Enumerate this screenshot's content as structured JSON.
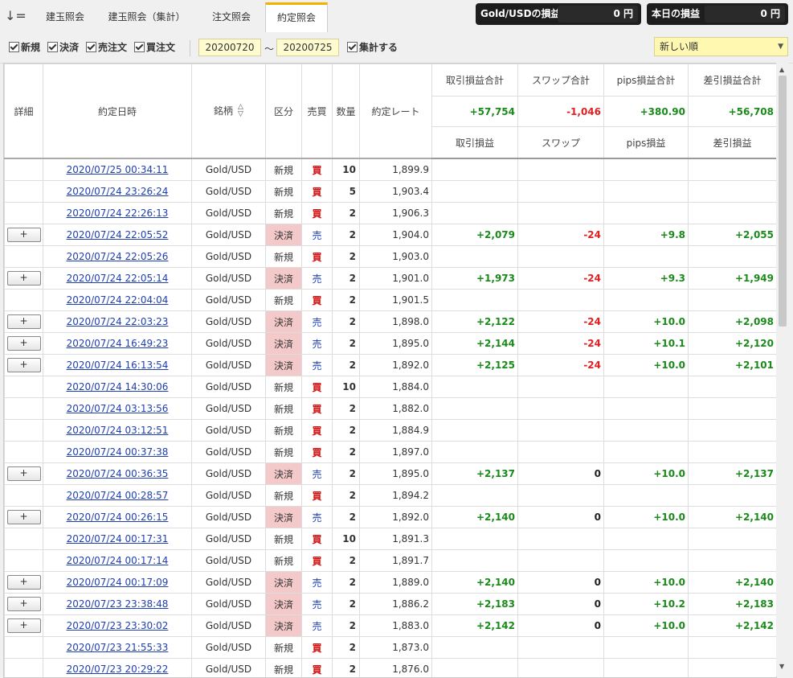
{
  "tabs": [
    {
      "label": "建玉照会",
      "active": false
    },
    {
      "label": "建玉照会（集計）",
      "active": false
    },
    {
      "label": "注文照会",
      "active": false
    },
    {
      "label": "約定照会",
      "active": true
    }
  ],
  "summary": {
    "pair_pl_label": "Gold/USDの損益",
    "pair_pl_value": "0 円",
    "today_pl_label": "本日の損益",
    "today_pl_value": "0 円"
  },
  "filters": {
    "new": "新規",
    "settle": "決済",
    "sell_order": "売注文",
    "buy_order": "買注文",
    "aggregate": "集計する",
    "date_from": "20200720",
    "date_to": "20200725",
    "tilde": "～",
    "sort_order": "新しい順"
  },
  "columns": {
    "detail": "詳細",
    "datetime": "約定日時",
    "symbol": "銘柄",
    "category": "区分",
    "side": "売買",
    "qty": "数量",
    "rate": "約定レート",
    "trade_pl_total": "取引損益合計",
    "swap_total": "スワップ合計",
    "pips_total": "pips損益合計",
    "net_total": "差引損益合計",
    "trade_pl": "取引損益",
    "swap": "スワップ",
    "pips": "pips損益",
    "net": "差引損益"
  },
  "totals": {
    "trade_pl": "+57,754",
    "swap": "-1,046",
    "pips": "+380.90",
    "net": "+56,708"
  },
  "rows": [
    {
      "detail": "",
      "dt": "2020/07/25 00:34:11",
      "sym": "Gold/USD",
      "cat": "新規",
      "side": "買",
      "qty": "10",
      "rate": "1,899.9",
      "pl": "",
      "swap": "",
      "pips": "",
      "net": ""
    },
    {
      "detail": "",
      "dt": "2020/07/24 23:26:24",
      "sym": "Gold/USD",
      "cat": "新規",
      "side": "買",
      "qty": "5",
      "rate": "1,903.4",
      "pl": "",
      "swap": "",
      "pips": "",
      "net": ""
    },
    {
      "detail": "",
      "dt": "2020/07/24 22:26:13",
      "sym": "Gold/USD",
      "cat": "新規",
      "side": "買",
      "qty": "2",
      "rate": "1,906.3",
      "pl": "",
      "swap": "",
      "pips": "",
      "net": ""
    },
    {
      "detail": "+",
      "dt": "2020/07/24 22:05:52",
      "sym": "Gold/USD",
      "cat": "決済",
      "side": "売",
      "qty": "2",
      "rate": "1,904.0",
      "pl": "+2,079",
      "swap": "-24",
      "pips": "+9.8",
      "net": "+2,055"
    },
    {
      "detail": "",
      "dt": "2020/07/24 22:05:26",
      "sym": "Gold/USD",
      "cat": "新規",
      "side": "買",
      "qty": "2",
      "rate": "1,903.0",
      "pl": "",
      "swap": "",
      "pips": "",
      "net": ""
    },
    {
      "detail": "+",
      "dt": "2020/07/24 22:05:14",
      "sym": "Gold/USD",
      "cat": "決済",
      "side": "売",
      "qty": "2",
      "rate": "1,901.0",
      "pl": "+1,973",
      "swap": "-24",
      "pips": "+9.3",
      "net": "+1,949"
    },
    {
      "detail": "",
      "dt": "2020/07/24 22:04:04",
      "sym": "Gold/USD",
      "cat": "新規",
      "side": "買",
      "qty": "2",
      "rate": "1,901.5",
      "pl": "",
      "swap": "",
      "pips": "",
      "net": ""
    },
    {
      "detail": "+",
      "dt": "2020/07/24 22:03:23",
      "sym": "Gold/USD",
      "cat": "決済",
      "side": "売",
      "qty": "2",
      "rate": "1,898.0",
      "pl": "+2,122",
      "swap": "-24",
      "pips": "+10.0",
      "net": "+2,098"
    },
    {
      "detail": "+",
      "dt": "2020/07/24 16:49:23",
      "sym": "Gold/USD",
      "cat": "決済",
      "side": "売",
      "qty": "2",
      "rate": "1,895.0",
      "pl": "+2,144",
      "swap": "-24",
      "pips": "+10.1",
      "net": "+2,120"
    },
    {
      "detail": "+",
      "dt": "2020/07/24 16:13:54",
      "sym": "Gold/USD",
      "cat": "決済",
      "side": "売",
      "qty": "2",
      "rate": "1,892.0",
      "pl": "+2,125",
      "swap": "-24",
      "pips": "+10.0",
      "net": "+2,101"
    },
    {
      "detail": "",
      "dt": "2020/07/24 14:30:06",
      "sym": "Gold/USD",
      "cat": "新規",
      "side": "買",
      "qty": "10",
      "rate": "1,884.0",
      "pl": "",
      "swap": "",
      "pips": "",
      "net": ""
    },
    {
      "detail": "",
      "dt": "2020/07/24 03:13:56",
      "sym": "Gold/USD",
      "cat": "新規",
      "side": "買",
      "qty": "2",
      "rate": "1,882.0",
      "pl": "",
      "swap": "",
      "pips": "",
      "net": ""
    },
    {
      "detail": "",
      "dt": "2020/07/24 03:12:51",
      "sym": "Gold/USD",
      "cat": "新規",
      "side": "買",
      "qty": "2",
      "rate": "1,884.9",
      "pl": "",
      "swap": "",
      "pips": "",
      "net": ""
    },
    {
      "detail": "",
      "dt": "2020/07/24 00:37:38",
      "sym": "Gold/USD",
      "cat": "新規",
      "side": "買",
      "qty": "2",
      "rate": "1,897.0",
      "pl": "",
      "swap": "",
      "pips": "",
      "net": ""
    },
    {
      "detail": "+",
      "dt": "2020/07/24 00:36:35",
      "sym": "Gold/USD",
      "cat": "決済",
      "side": "売",
      "qty": "2",
      "rate": "1,895.0",
      "pl": "+2,137",
      "swap": "0",
      "pips": "+10.0",
      "net": "+2,137"
    },
    {
      "detail": "",
      "dt": "2020/07/24 00:28:57",
      "sym": "Gold/USD",
      "cat": "新規",
      "side": "買",
      "qty": "2",
      "rate": "1,894.2",
      "pl": "",
      "swap": "",
      "pips": "",
      "net": ""
    },
    {
      "detail": "+",
      "dt": "2020/07/24 00:26:15",
      "sym": "Gold/USD",
      "cat": "決済",
      "side": "売",
      "qty": "2",
      "rate": "1,892.0",
      "pl": "+2,140",
      "swap": "0",
      "pips": "+10.0",
      "net": "+2,140"
    },
    {
      "detail": "",
      "dt": "2020/07/24 00:17:31",
      "sym": "Gold/USD",
      "cat": "新規",
      "side": "買",
      "qty": "10",
      "rate": "1,891.3",
      "pl": "",
      "swap": "",
      "pips": "",
      "net": ""
    },
    {
      "detail": "",
      "dt": "2020/07/24 00:17:14",
      "sym": "Gold/USD",
      "cat": "新規",
      "side": "買",
      "qty": "2",
      "rate": "1,891.7",
      "pl": "",
      "swap": "",
      "pips": "",
      "net": ""
    },
    {
      "detail": "+",
      "dt": "2020/07/24 00:17:09",
      "sym": "Gold/USD",
      "cat": "決済",
      "side": "売",
      "qty": "2",
      "rate": "1,889.0",
      "pl": "+2,140",
      "swap": "0",
      "pips": "+10.0",
      "net": "+2,140"
    },
    {
      "detail": "+",
      "dt": "2020/07/23 23:38:48",
      "sym": "Gold/USD",
      "cat": "決済",
      "side": "売",
      "qty": "2",
      "rate": "1,886.2",
      "pl": "+2,183",
      "swap": "0",
      "pips": "+10.2",
      "net": "+2,183"
    },
    {
      "detail": "+",
      "dt": "2020/07/23 23:30:02",
      "sym": "Gold/USD",
      "cat": "決済",
      "side": "売",
      "qty": "2",
      "rate": "1,883.0",
      "pl": "+2,142",
      "swap": "0",
      "pips": "+10.0",
      "net": "+2,142"
    },
    {
      "detail": "",
      "dt": "2020/07/23 21:55:33",
      "sym": "Gold/USD",
      "cat": "新規",
      "side": "買",
      "qty": "2",
      "rate": "1,873.0",
      "pl": "",
      "swap": "",
      "pips": "",
      "net": ""
    },
    {
      "detail": "",
      "dt": "2020/07/23 20:29:22",
      "sym": "Gold/USD",
      "cat": "新規",
      "side": "買",
      "qty": "2",
      "rate": "1,876.0",
      "pl": "",
      "swap": "",
      "pips": "",
      "net": ""
    }
  ]
}
